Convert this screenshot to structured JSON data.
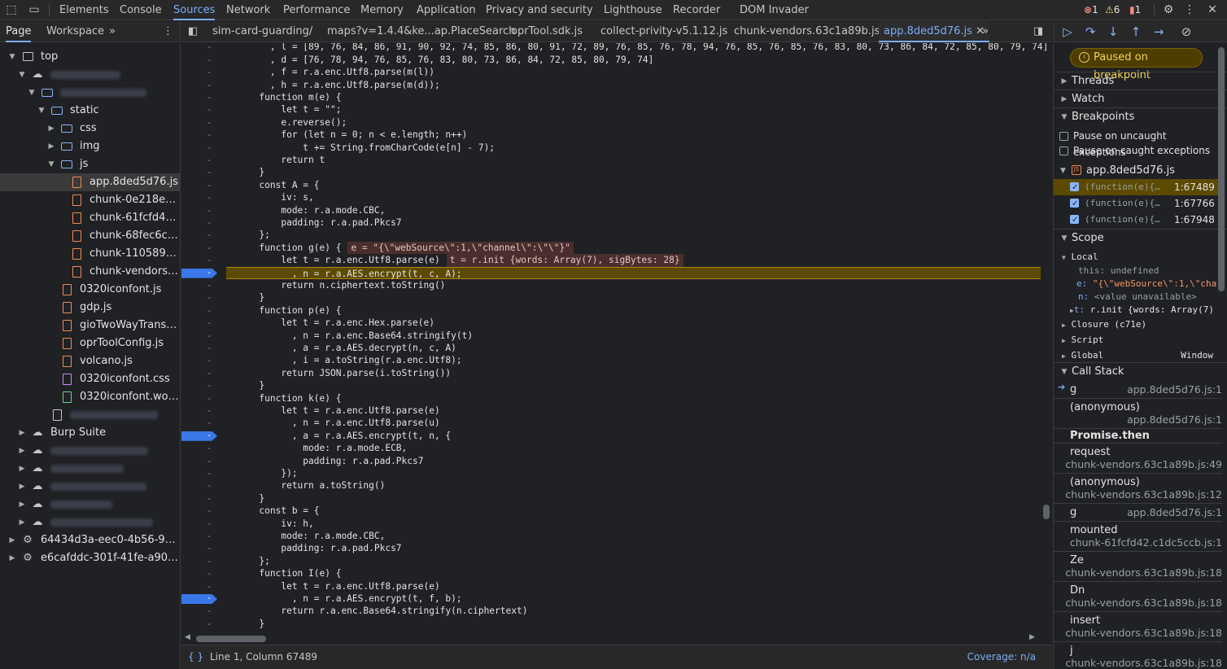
{
  "toolbar": {
    "tabs": [
      "Elements",
      "Console",
      "Sources",
      "Network",
      "Performance",
      "Memory",
      "Application",
      "Privacy and security",
      "Lighthouse",
      "Recorder",
      "DOM Invader"
    ],
    "active_tab": "Sources",
    "errors": "1",
    "warnings": "6",
    "issues": "1",
    "colors": {
      "error": "#f28b82",
      "warning": "#fdd663",
      "issue": "#8ab4f8",
      "accent": "#7cacf8"
    }
  },
  "navigator": {
    "tabs": [
      "Page",
      "Workspace"
    ],
    "more": "»",
    "tree": {
      "top": "top",
      "static": "static",
      "css": "css",
      "img": "img",
      "js": "js",
      "js_files": [
        "app.8ded5d76.js",
        "chunk-0e218ee6...",
        "chunk-61fcfd42....",
        "chunk-68fec6cc....",
        "chunk-1105895d...",
        "chunk-vendors.6..."
      ],
      "static_files": [
        "0320iconfont.js",
        "gdp.js",
        "gioTwoWayTransm...",
        "oprToolConfig.js",
        "volcano.js",
        "0320iconfont.css",
        "0320iconfont.woff..."
      ],
      "burp": "Burp Suite",
      "workers": [
        "64434d3a-eec0-4b56-9b6c-...",
        "e6cafddc-301f-41fe-a908-2..."
      ]
    }
  },
  "editor": {
    "tabs": [
      "sim-card-guarding/",
      "maps?v=1.4.4&ke...ap.PlaceSearch",
      "oprTool.sdk.js",
      "collect-privity-v5.1.12.js",
      "chunk-vendors.63c1a89b.js",
      "app.8ded5d76.js"
    ],
    "active_tab": "app.8ded5d76.js",
    "more": "»",
    "lines": [
      "        , l = [89, 76, 84, 86, 91, 90, 92, 74, 85, 86, 80, 91, 72, 89, 76, 85, 76, 78, 94, 76, 85, 76, 85, 76, 83, 80, 73, 86, 84, 72, 85, 80, 79, 74]",
      "        , d = [76, 78, 94, 76, 85, 76, 83, 80, 73, 86, 84, 72, 85, 80, 79, 74]",
      "        , f = r.a.enc.Utf8.parse(m(l))",
      "        , h = r.a.enc.Utf8.parse(m(d));",
      "      function m(e) {",
      "          let t = \"\";",
      "          e.reverse();",
      "          for (let n = 0; n < e.length; n++)",
      "              t += String.fromCharCode(e[n] - 7);",
      "          return t",
      "      }",
      "      const A = {",
      "          iv: s,",
      "          mode: r.a.mode.CBC,",
      "          padding: r.a.pad.Pkcs7",
      "      };",
      "      function g(e) {",
      "          let t = r.a.enc.Utf8.parse(e)",
      "            , n = r.a.AES.encrypt(t, c, A);",
      "          return n.ciphertext.toString()",
      "      }",
      "      function p(e) {",
      "          let t = r.a.enc.Hex.parse(e)",
      "            , n = r.a.enc.Base64.stringify(t)",
      "            , a = r.a.AES.decrypt(n, c, A)",
      "            , i = a.toString(r.a.enc.Utf8);",
      "          return JSON.parse(i.toString())",
      "      }",
      "      function k(e) {",
      "          let t = r.a.enc.Utf8.parse(e)",
      "            , n = r.a.enc.Utf8.parse(u)",
      "            , a = r.a.AES.encrypt(t, n, {",
      "              mode: r.a.mode.ECB,",
      "              padding: r.a.pad.Pkcs7",
      "          });",
      "          return a.toString()",
      "      }",
      "      const b = {",
      "          iv: h,",
      "          mode: r.a.mode.CBC,",
      "          padding: r.a.pad.Pkcs7",
      "      };",
      "      function I(e) {",
      "          let t = r.a.enc.Utf8.parse(e)",
      "            , n = r.a.AES.encrypt(t, f, b);",
      "          return r.a.enc.Base64.stringify(n.ciphertext)",
      "      }"
    ],
    "inline_values": {
      "g_e": "e = \"{\\\"webSource\\\":1,\\\"channel\\\":\\\"\\\"}\"",
      "g_t": "t = r.init {words: Array(7), sigBytes: 28}"
    },
    "paused_line_index": 18,
    "breakpoint_line_indices": [
      18,
      31,
      44
    ]
  },
  "status": {
    "position": "Line 1, Column 67489",
    "coverage": "Coverage: n/a"
  },
  "debugger": {
    "paused_label": "Paused on breakpoint",
    "threads": "Threads",
    "watch": "Watch",
    "breakpoints": "Breakpoints",
    "pause_uncaught": "Pause on uncaught exceptions",
    "pause_caught": "Pause on caught exceptions",
    "bp_file": "app.8ded5d76.js",
    "bp_items": [
      {
        "code": "(function(e){…",
        "loc": "1:67489"
      },
      {
        "code": "(function(e){…",
        "loc": "1:67766"
      },
      {
        "code": "(function(e){…",
        "loc": "1:67948"
      }
    ],
    "scope": "Scope",
    "local": "Local",
    "this_row": "this: undefined",
    "e_key": "e:",
    "e_val": "\"{\\\"webSource\\\":1,\\\"cha",
    "n_key": "n:",
    "n_val": "<value unavailable>",
    "t_key": "t:",
    "t_val": "r.init {words: Array(7)",
    "closure": "Closure (c71e)",
    "script": "Script",
    "global": "Global",
    "global_val": "Window",
    "call_stack": "Call Stack",
    "stack": [
      {
        "fn": "g",
        "src": "app.8ded5d76.js:1"
      },
      {
        "fn": "(anonymous)",
        "src": "app.8ded5d76.js:1"
      },
      {
        "fn": "Promise.then",
        "src": ""
      },
      {
        "fn": "request",
        "src": "chunk-vendors.63c1a89b.js:49"
      },
      {
        "fn": "(anonymous)",
        "src": "chunk-vendors.63c1a89b.js:12"
      },
      {
        "fn": "g",
        "src": "app.8ded5d76.js:1"
      },
      {
        "fn": "mounted",
        "src": "chunk-61fcfd42.c1dc5ccb.js:1"
      },
      {
        "fn": "Ze",
        "src": "chunk-vendors.63c1a89b.js:18"
      },
      {
        "fn": "Dn",
        "src": "chunk-vendors.63c1a89b.js:18"
      },
      {
        "fn": "insert",
        "src": "chunk-vendors.63c1a89b.js:18"
      },
      {
        "fn": "j",
        "src": "chunk-vendors.63c1a89b.js:18"
      }
    ]
  }
}
